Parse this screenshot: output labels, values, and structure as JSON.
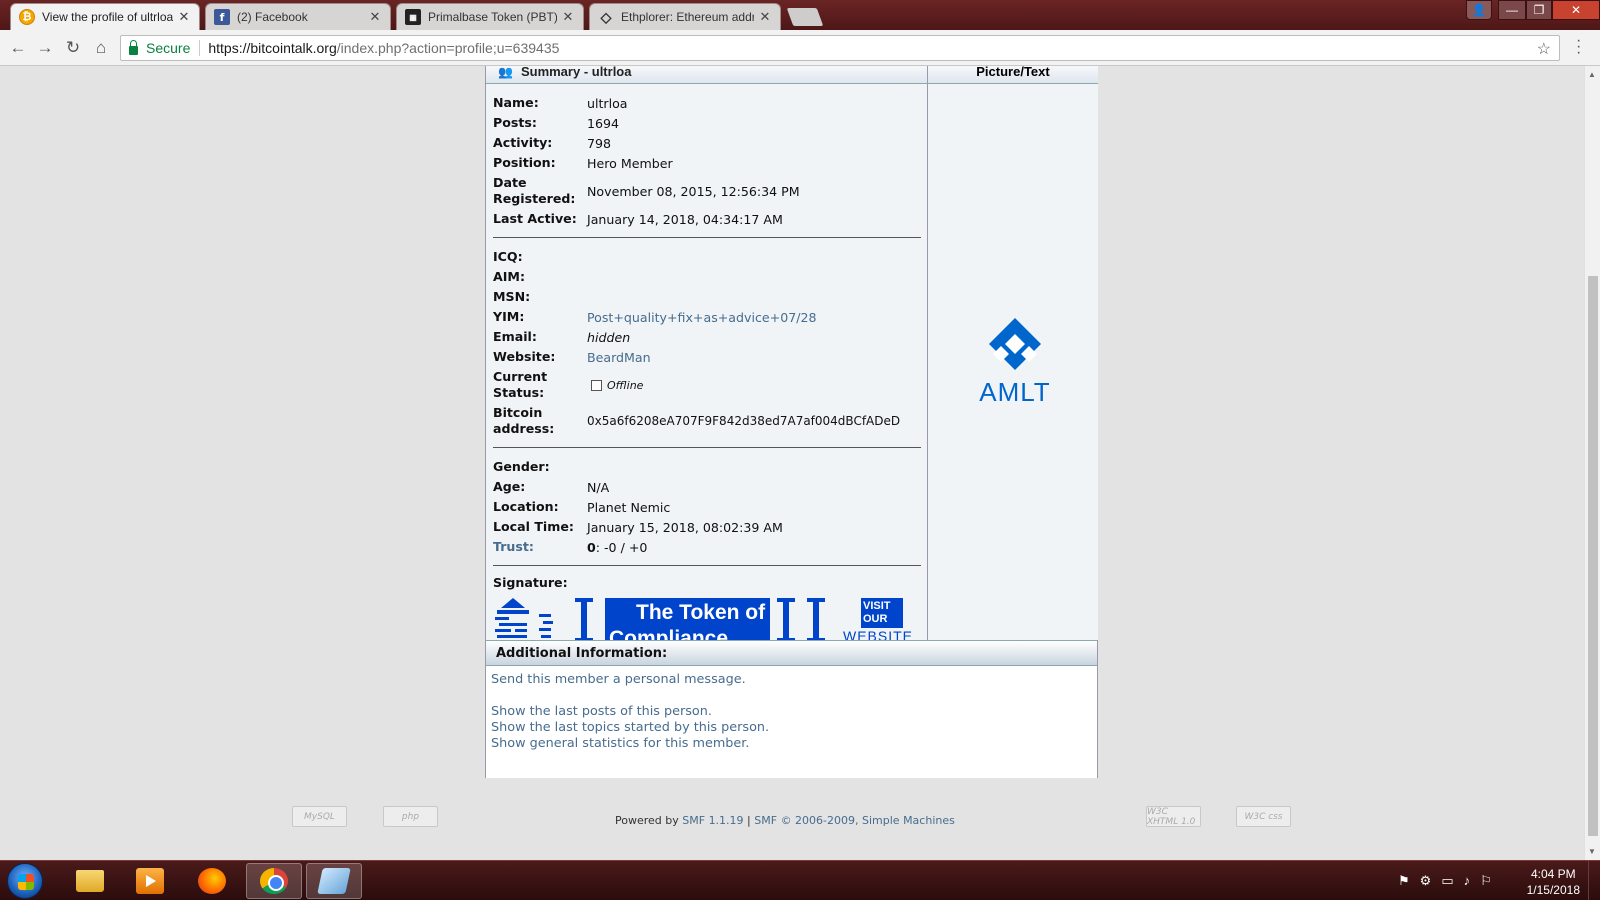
{
  "browser": {
    "tabs": [
      {
        "title": "View the profile of ultrloa",
        "icon": "bitcoin-icon"
      },
      {
        "title": "(2) Facebook",
        "icon": "facebook-icon"
      },
      {
        "title": "Primalbase Token (PBT) S",
        "icon": "primalbase-icon"
      },
      {
        "title": "Ethplorer: Ethereum addr",
        "icon": "ethereum-icon"
      }
    ],
    "secure_label": "Secure",
    "url_host": "https://bitcointalk.org",
    "url_path": "/index.php?action=profile;u=639435"
  },
  "profile": {
    "summary_title": "Summary - ultrloa",
    "picture_title": "Picture/Text",
    "fields": {
      "name_label": "Name:",
      "name": "ultrloa",
      "posts_label": "Posts:",
      "posts": "1694",
      "activity_label": "Activity:",
      "activity": "798",
      "position_label": "Position:",
      "position": "Hero Member",
      "date_label_1": "Date",
      "date_label_2": "Registered:",
      "date_registered": "November 08, 2015, 12:56:34 PM",
      "last_active_label": "Last Active:",
      "last_active": "January 14, 2018, 04:34:17 AM",
      "icq_label": "ICQ:",
      "aim_label": "AIM:",
      "msn_label": "MSN:",
      "yim_label": "YIM:",
      "yim": "Post+quality+fix+as+advice+07/28",
      "email_label": "Email:",
      "email": "hidden",
      "website_label": "Website:",
      "website": "BeardMan",
      "status_label_1": "Current",
      "status_label_2": "Status:",
      "status": "Offline",
      "btc_label_1": "Bitcoin",
      "btc_label_2": "address:",
      "btc_address": "0x5a6f6208eA707F9F842d38ed7A7af004dBCfADeD",
      "gender_label": "Gender:",
      "age_label": "Age:",
      "age": "N/A",
      "location_label": "Location:",
      "location": "Planet Nemic",
      "local_time_label": "Local Time:",
      "local_time": "January 15, 2018, 08:02:39 AM",
      "trust_label": "Trust:",
      "trust_score": "0",
      "trust_rest": ": -0 / +0",
      "signature_label": "Signature:"
    },
    "signature": {
      "banner_line_1": "The Token of",
      "banner_line_2": "Compliance",
      "visit_1": "VISIT",
      "visit_2": "OUR",
      "website": "WEBSITE"
    },
    "avatar_text": "AMLT",
    "additional": {
      "title": "Additional Information:",
      "links": [
        "Send this member a personal message.",
        "Show the last posts of this person.",
        "Show the last topics started by this person.",
        "Show general statistics for this member."
      ]
    }
  },
  "footer": {
    "powered_by": "Powered by",
    "smf_version": "SMF 1.1.19",
    "separator": " | ",
    "copyright": "SMF © 2006-2009, Simple Machines",
    "badges": [
      "MySQL",
      "php",
      "W3C XHTML 1.0",
      "W3C css"
    ]
  },
  "taskbar": {
    "time": "4:04 PM",
    "date": "1/15/2018"
  }
}
